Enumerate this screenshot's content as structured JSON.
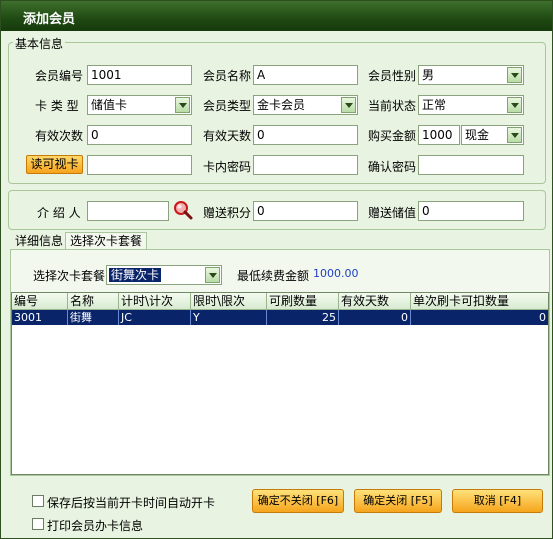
{
  "window": {
    "title": "添加会员"
  },
  "basic_info": {
    "legend": "基本信息",
    "member_no": {
      "label": "会员编号",
      "value": "1001"
    },
    "member_name": {
      "label": "会员名称",
      "value": "A"
    },
    "gender": {
      "label": "会员性别",
      "value": "男"
    },
    "card_type": {
      "label": "卡 类 型",
      "value": "储值卡"
    },
    "member_type": {
      "label": "会员类型",
      "value": "金卡会员"
    },
    "status": {
      "label": "当前状态",
      "value": "正常"
    },
    "valid_times": {
      "label": "有效次数",
      "value": "0"
    },
    "valid_days": {
      "label": "有效天数",
      "value": "0"
    },
    "purchase_amount": {
      "label": "购买金额",
      "value": "1000",
      "pay_method": "现金"
    },
    "read_card_button": "读可视卡",
    "card_password": {
      "label": "卡内密码",
      "value": ""
    },
    "confirm_password": {
      "label": "确认密码",
      "value": ""
    }
  },
  "referral": {
    "referrer": {
      "label": "介 绍 人",
      "value": ""
    },
    "gift_points": {
      "label": "赠送积分",
      "value": "0"
    },
    "gift_stored": {
      "label": "赠送储值",
      "value": "0"
    }
  },
  "tabs": [
    "详细信息",
    "选择次卡套餐"
  ],
  "package": {
    "select_label": "选择次卡套餐",
    "selected": "街舞次卡",
    "min_renew_label": "最低续费金额",
    "min_renew_value": "1000.00"
  },
  "grid": {
    "headers": [
      "编号",
      "名称",
      "计时\\计次",
      "限时\\限次",
      "可刷数量",
      "有效天数",
      "单次刷卡可扣数量"
    ],
    "rows": [
      [
        "3001",
        "街舞",
        "JC",
        "Y",
        "25",
        "0",
        "0"
      ]
    ]
  },
  "options": {
    "auto_open": "保存后按当前开卡时间自动开卡",
    "print_info": "打印会员办卡信息"
  },
  "buttons": {
    "confirm_keep": "确定不关闭 [F6]",
    "confirm_close": "确定关闭 [F5]",
    "cancel": "取消 [F4]"
  },
  "colors": {
    "title_bar": "#1f4a12",
    "window_bg": "#e8f3e1",
    "accent_button": "#f5a41c",
    "selected_row": "#0a246a",
    "min_renew_value": "#1f3fbf"
  }
}
